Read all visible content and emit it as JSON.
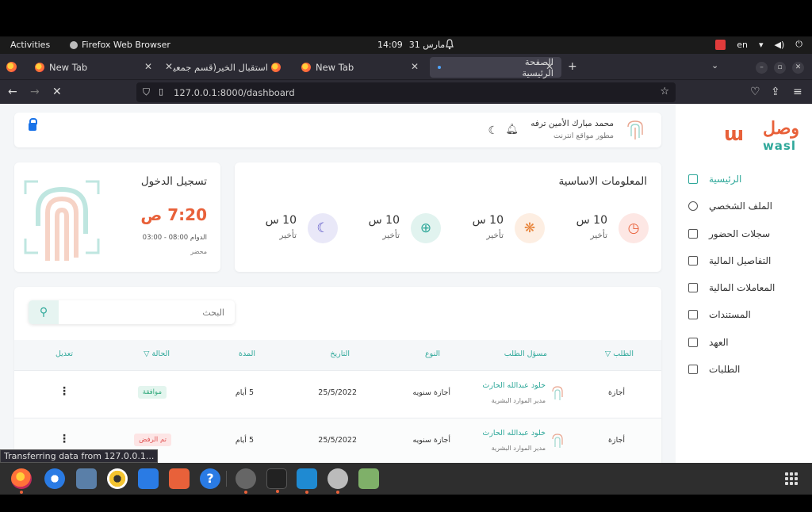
{
  "system": {
    "activities": "Activities",
    "app_name": "Firefox Web Browser",
    "clock_time": "14:09",
    "clock_date": "31 مارس",
    "language": "en"
  },
  "browser": {
    "tabs": [
      {
        "label": "New Tab",
        "active": false
      },
      {
        "label": "استقبال الخير(قسم جمعية الدعـ",
        "active": false
      },
      {
        "label": "New Tab",
        "active": false
      },
      {
        "label": "الصفحة الرئيسية",
        "active": true
      }
    ],
    "url": "127.0.0.1:8000/dashboard",
    "status": "Transferring data from 127.0.0.1..."
  },
  "sidebar": {
    "logo_ar": "وصل",
    "logo_en": "wasl",
    "items": [
      {
        "label": "الرئيسية",
        "icon": "home-icon",
        "active": true
      },
      {
        "label": "الملف الشخصي",
        "icon": "user-icon",
        "active": false
      },
      {
        "label": "سجلات الحضور",
        "icon": "calendar-icon",
        "active": false
      },
      {
        "label": "التفاصيل المالية",
        "icon": "card-icon",
        "active": false
      },
      {
        "label": "المعاملات المالية",
        "icon": "card-icon",
        "active": false
      },
      {
        "label": "المستندات",
        "icon": "document-icon",
        "active": false
      },
      {
        "label": "العهد",
        "icon": "box-icon",
        "active": false
      },
      {
        "label": "الطلبات",
        "icon": "requests-icon",
        "active": false
      }
    ]
  },
  "header": {
    "user_name": "محمد مبارك الأمين ترفه",
    "user_role": "مطور مواقع انترنت"
  },
  "info": {
    "title": "المعلومات الاساسية",
    "stats": [
      {
        "value": "10 س",
        "label": "تأخير",
        "icon": "clock-icon",
        "color": "#e8613a",
        "bg": "#fde7e4"
      },
      {
        "value": "10 س",
        "label": "تأخير",
        "icon": "fingerprint-icon",
        "color": "#e8843a",
        "bg": "#fdeee2"
      },
      {
        "value": "10 س",
        "label": "تأخير",
        "icon": "plus-circle-icon",
        "color": "#2fa89a",
        "bg": "#e1f3ef"
      },
      {
        "value": "10 س",
        "label": "تأخير",
        "icon": "moon-icon",
        "color": "#5b55c7",
        "bg": "#e9e8f8"
      }
    ]
  },
  "login": {
    "title": "تسجيل الدخول",
    "time": "7:20 ص",
    "shift": "الدوام 08:00 - 03:00",
    "status": "محضر"
  },
  "table": {
    "search_placeholder": "البحث",
    "headers": {
      "request": "الطلب",
      "requester": "مسؤل الطلب",
      "type": "النوع",
      "date": "التاريخ",
      "duration": "المدة",
      "status": "الحالة",
      "edit": "تعديل"
    },
    "rows": [
      {
        "request": "أجازة",
        "name": "خلود عبدالله الحارث",
        "role": "مدير الموارد البشرية",
        "type": "أجازة سنويه",
        "date": "25/5/2022",
        "duration": "5 أيام",
        "status": "موافقة",
        "status_kind": "ok"
      },
      {
        "request": "أجازة",
        "name": "خلود عبدالله الحارث",
        "role": "مدير الموارد البشرية",
        "type": "أجازة سنويه",
        "date": "25/5/2022",
        "duration": "5 أيام",
        "status": "تم الرفض",
        "status_kind": "no"
      }
    ]
  },
  "dock": {
    "apps": [
      "firefox-icon",
      "thunderbird-icon",
      "files-icon",
      "rhythmbox-icon",
      "writer-icon",
      "software-icon",
      "help-icon",
      "settings-icon",
      "terminal-icon",
      "vscode-icon",
      "updater-icon",
      "trash-icon"
    ]
  }
}
